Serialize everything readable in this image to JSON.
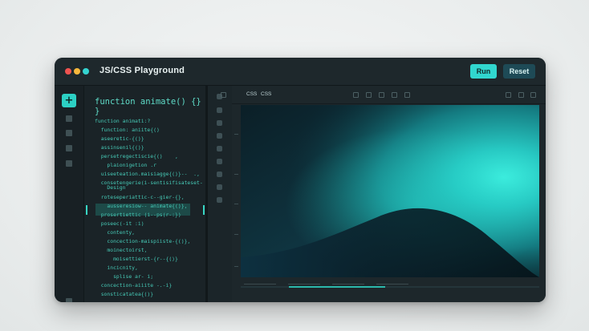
{
  "window": {
    "title": "JS/CSS Playground",
    "run_label": "Run",
    "reset_label": "Reset"
  },
  "sidebar": {
    "add_label": "+"
  },
  "editor": {
    "heading_lines": [
      "function animate() {}",
      "}"
    ],
    "lines": [
      "function animati:?",
      "  function: aniite{()",
      "  aseeretic-{()}",
      "  assinsenil{()}",
      "  persetregectiscie{()    ,",
      "    plaionigetion .r",
      "  uiseeteation.maisiagge{()}--  .,",
      "  consetengerie(i-sentisifisateset-",
      "    Design",
      "  roteseperiattic-c--gier-{},",
      "    ausseresiow-- animate{()},",
      "  prosertiettic (i--ps(r-:})",
      "  poseec(-it :i)",
      "    contenty,",
      "    concection-maispiiste-{()},",
      "    moinectoirst,",
      "      moisettierst-{r--{()}",
      "    incicnity,",
      "      splise ar- i;",
      "  concection-aiiite -.-i}",
      "  sonsticatatea{()}"
    ]
  },
  "preview": {
    "tabs": [
      "CSS",
      "CSS"
    ]
  },
  "colors": {
    "accent": "#31d7cf",
    "window_bg": "#1b2428",
    "code": "#46c9b6",
    "reset_bg": "#1e4a56"
  }
}
